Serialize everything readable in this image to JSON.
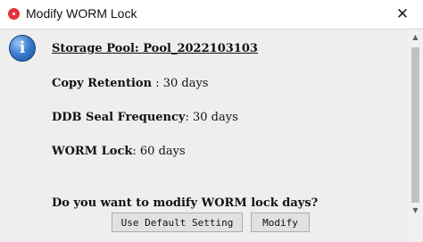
{
  "window": {
    "title": "Modify WORM Lock",
    "close_glyph": "✕"
  },
  "dialog": {
    "info_glyph": "i",
    "storage_pool": "Storage Pool: Pool_2022103103",
    "copy_retention": {
      "label": "Copy Retention",
      "value": " : 30 days"
    },
    "ddb_seal": {
      "label": "DDB Seal Frequency",
      "value": ": 30 days"
    },
    "worm_lock": {
      "label": "WORM Lock",
      "value": ": 60 days"
    },
    "question": "Do you want to modify WORM lock days?"
  },
  "buttons": {
    "default_label": "Use Default Setting",
    "modify_label": "Modify"
  },
  "scrollbar": {
    "up_glyph": "▲",
    "down_glyph": "▼"
  },
  "colors": {
    "app_icon": "#e3313b",
    "info_icon": "#3d7fd0",
    "dialog_bg": "#eeeeee"
  }
}
